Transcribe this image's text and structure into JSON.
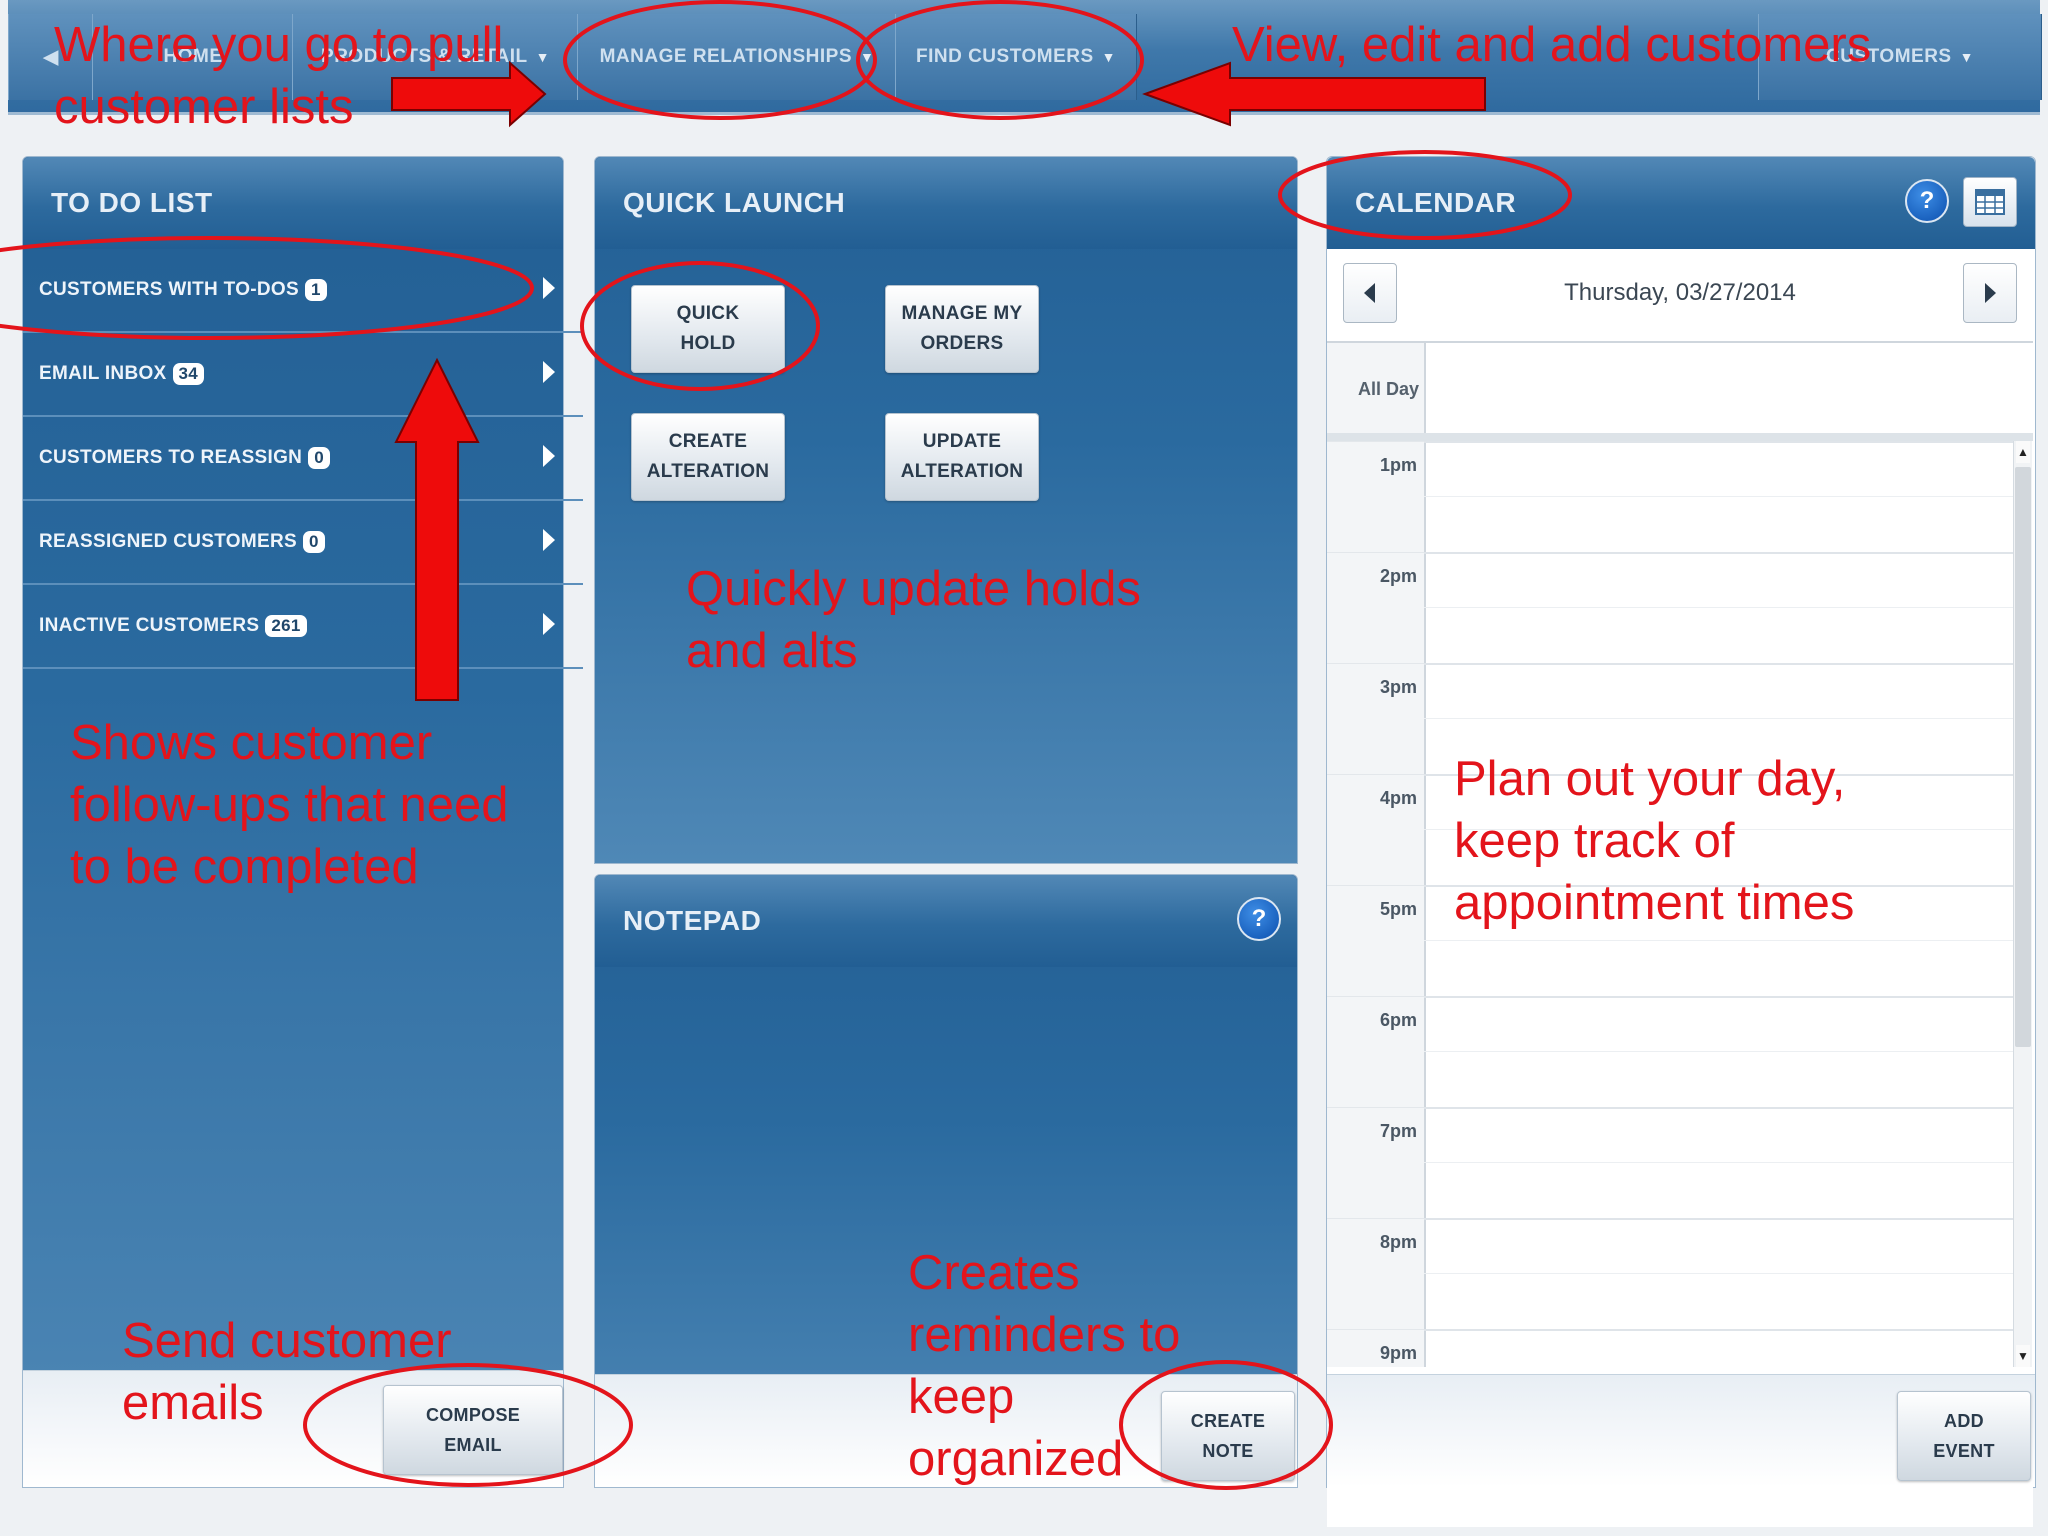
{
  "nav": {
    "items": [
      {
        "label": "HOME"
      },
      {
        "label": "PRODUCTS & RETAIL"
      },
      {
        "label": "MANAGE RELATIONSHIPS"
      },
      {
        "label": "FIND CUSTOMERS"
      },
      {
        "label": "CUSTOMERS"
      }
    ]
  },
  "todo": {
    "title": "TO DO LIST",
    "items": [
      {
        "label": "CUSTOMERS WITH TO-DOS",
        "count": "1"
      },
      {
        "label": "EMAIL INBOX",
        "count": "34"
      },
      {
        "label": "CUSTOMERS TO REASSIGN",
        "count": "0"
      },
      {
        "label": "REASSIGNED CUSTOMERS",
        "count": "0"
      },
      {
        "label": "INACTIVE CUSTOMERS",
        "count": "261"
      }
    ],
    "compose_label": "COMPOSE\nEMAIL"
  },
  "quick_launch": {
    "title": "QUICK LAUNCH",
    "buttons": [
      {
        "label": "QUICK\nHOLD"
      },
      {
        "label": "MANAGE MY\nORDERS"
      },
      {
        "label": "CREATE\nALTERATION"
      },
      {
        "label": "UPDATE\nALTERATION"
      }
    ]
  },
  "notepad": {
    "title": "NOTEPAD",
    "help": "?",
    "create_label": "CREATE\nNOTE"
  },
  "calendar": {
    "title": "CALENDAR",
    "help": "?",
    "date": "Thursday, 03/27/2014",
    "all_day": "All Day",
    "hours": [
      "1pm",
      "2pm",
      "3pm",
      "4pm",
      "5pm",
      "6pm",
      "7pm",
      "8pm",
      "9pm"
    ],
    "add_event_label": "ADD\nEVENT"
  },
  "annotations": {
    "pull_lists": "Where you go to pull\ncustomer lists",
    "view_customers": "View, edit and add customers",
    "followups": "Shows customer\nfollow-ups that need\nto be completed",
    "holds_alts": "Quickly update holds\nand alts",
    "plan_day": "Plan out your day,\nkeep track of\nappointment times",
    "send_emails": "Send customer\nemails",
    "reminders": "Creates\nreminders to\nkeep\norganized"
  },
  "colors": {
    "panel_blue": "#2a6a9f",
    "annotation_red": "#e3141b"
  }
}
